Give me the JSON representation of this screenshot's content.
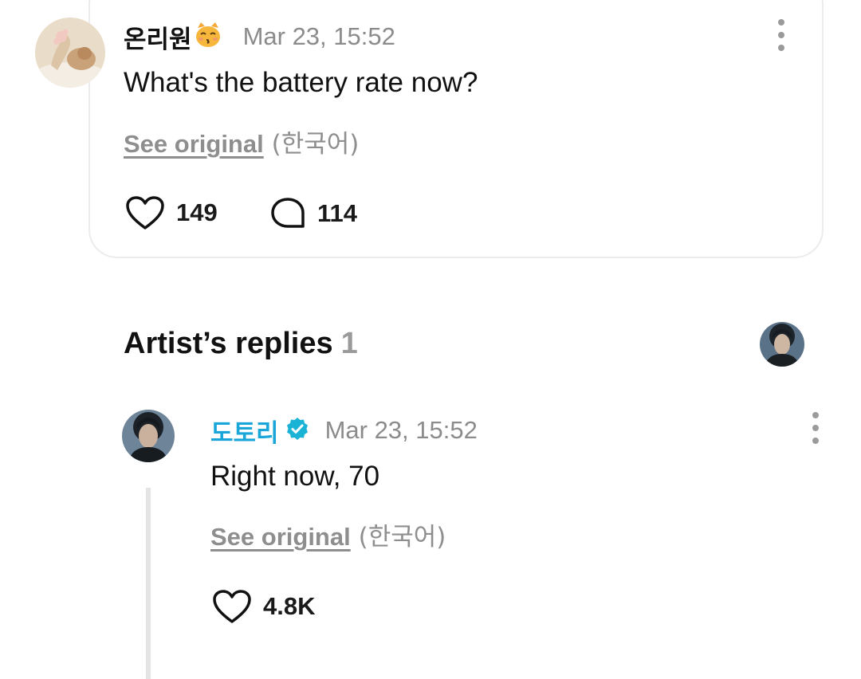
{
  "comment": {
    "username": "온리원",
    "username_emoji": "😽",
    "timestamp": "Mar 23, 15:52",
    "text": "What's the battery rate now?",
    "see_original_label": "See original",
    "original_language": "(한국어)",
    "likes": "149",
    "replies": "114"
  },
  "artist_replies": {
    "title": "Artist’s replies",
    "count": "1"
  },
  "reply": {
    "username": "도토리",
    "timestamp": "Mar 23, 15:52",
    "text": "Right now, 70",
    "see_original_label": "See original",
    "original_language": "(한국어)",
    "likes": "4.8K"
  },
  "colors": {
    "artist_name": "#1aa6d9",
    "verified_badge": "#1ab3d6",
    "muted_text": "#8b8b8b"
  }
}
